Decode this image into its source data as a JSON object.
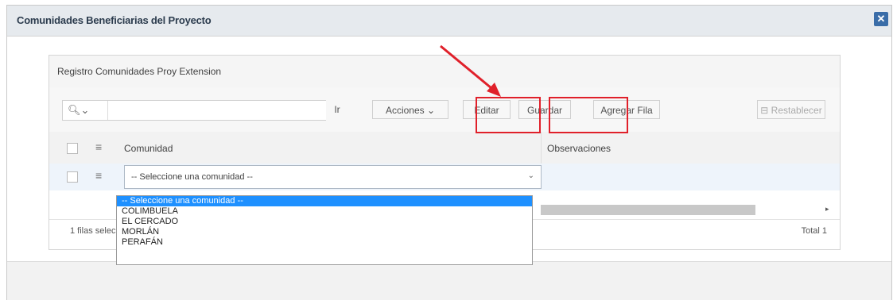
{
  "dialog": {
    "title": "Comunidades Beneficiarias del Proyecto",
    "close_icon": "close-icon"
  },
  "region": {
    "title": "Registro Comunidades Proy Extension"
  },
  "toolbar": {
    "search_icon": "search-icon",
    "search_caret": "⌄",
    "search_placeholder": "",
    "go_label": "Ir",
    "actions_label": "Acciones ⌄",
    "edit_label": "Editar",
    "save_label": "Guardar",
    "add_row_label": "Agregar Fila",
    "reset_label": "Restablecer"
  },
  "grid": {
    "columns": [
      "Comunidad",
      "Observaciones"
    ],
    "row": {
      "selected_value": "-- Seleccione una comunidad --"
    },
    "dropdown_options": [
      "-- Seleccione una comunidad --",
      "COLIMBUELA",
      "EL CERCADO",
      "MORLÁN",
      "PERAFÁN"
    ],
    "status_text": "1 filas selec",
    "total_text": "Total 1"
  },
  "colors": {
    "highlight_red": "#e0202a",
    "selection_blue": "#1e90ff",
    "close_blue": "#3a6da8"
  }
}
